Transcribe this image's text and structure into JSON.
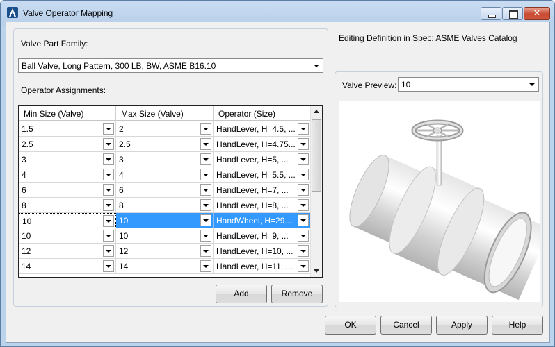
{
  "window": {
    "title": "Valve Operator Mapping",
    "close_glyph": "✕"
  },
  "left": {
    "part_family_label": "Valve Part Family:",
    "part_family_value": "Ball Valve, Long Pattern, 300 LB, BW, ASME B16.10",
    "assignments_label": "Operator Assignments:",
    "columns": [
      "Min Size (Valve)",
      "Max Size (Valve)",
      "Operator (Size)"
    ],
    "rows": [
      [
        "1.5",
        "2",
        "HandLever, H=4.5, ..."
      ],
      [
        "2.5",
        "2.5",
        "HandLever, H=4.75..."
      ],
      [
        "3",
        "3",
        "HandLever, H=5, ..."
      ],
      [
        "4",
        "4",
        "HandLever, H=5.5, ..."
      ],
      [
        "6",
        "6",
        "HandLever, H=7, ..."
      ],
      [
        "8",
        "8",
        "HandLever, H=8, ..."
      ],
      [
        "10",
        "10",
        "HandWheel, H=29...."
      ],
      [
        "10",
        "10",
        "HandLever, H=9, ..."
      ],
      [
        "12",
        "12",
        "HandLever, H=10, ..."
      ],
      [
        "14",
        "14",
        "HandLever, H=11, ..."
      ]
    ],
    "selected_row": 6,
    "add_label": "Add",
    "remove_label": "Remove"
  },
  "right": {
    "spec_label": "Editing Definition in Spec: ASME Valves Catalog",
    "preview_label": "Valve Preview:",
    "preview_value": "10"
  },
  "footer": {
    "ok": "OK",
    "cancel": "Cancel",
    "apply": "Apply",
    "help": "Help"
  }
}
